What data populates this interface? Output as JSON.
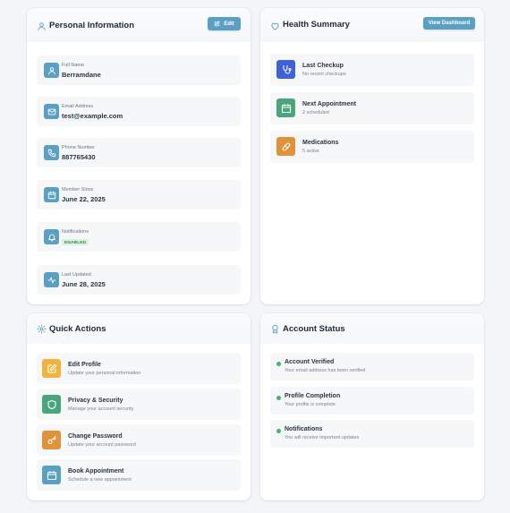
{
  "personal": {
    "title": "Personal Information",
    "edit_label": "Edit",
    "items": [
      {
        "label": "Full Name",
        "value": "Berramdane"
      },
      {
        "label": "Email Address",
        "value": "test@example.com"
      },
      {
        "label": "Phone Number",
        "value": "887765430"
      },
      {
        "label": "Member Since",
        "value": "June 22, 2025"
      },
      {
        "label": "Notifications",
        "badge": "ENABLED"
      },
      {
        "label": "Last Updated",
        "value": "June 28, 2025"
      }
    ]
  },
  "health": {
    "title": "Health Summary",
    "dashboard_label": "View Dashboard",
    "items": [
      {
        "title": "Last Checkup",
        "subtitle": "No recent checkups"
      },
      {
        "title": "Next Appointment",
        "subtitle": "2 scheduled"
      },
      {
        "title": "Medications",
        "subtitle": "5 active"
      }
    ]
  },
  "quick": {
    "title": "Quick Actions",
    "items": [
      {
        "title": "Edit Profile",
        "subtitle": "Update your personal information"
      },
      {
        "title": "Privacy & Security",
        "subtitle": "Manage your account security"
      },
      {
        "title": "Change Password",
        "subtitle": "Update your account password"
      },
      {
        "title": "Book Appointment",
        "subtitle": "Schedule a new appointment"
      }
    ]
  },
  "account": {
    "title": "Account Status",
    "items": [
      {
        "title": "Account Verified",
        "subtitle": "Your email address has been verified"
      },
      {
        "title": "Profile Completion",
        "subtitle": "Your profile is complete"
      },
      {
        "title": "Notifications",
        "subtitle": "You will receive important updates"
      }
    ]
  },
  "colors": {
    "accent": "#5aa0c3",
    "blue": "#3f63d6",
    "green": "#4aa57c",
    "orange": "#e0923b",
    "yellow": "#f0b43c",
    "status": "#4caf72"
  },
  "icons": {
    "personal_header": "user-icon",
    "edit": "edit-icon",
    "personal_items": [
      "user-icon",
      "mail-icon",
      "phone-icon",
      "calendar-icon",
      "bell-icon",
      "activity-icon"
    ],
    "health_header": "heart-icon",
    "health_items": [
      "stethoscope-icon",
      "calendar-icon",
      "pill-icon"
    ],
    "quick_header": "gear-icon",
    "quick_items": [
      "edit-icon",
      "shield-icon",
      "key-icon",
      "calendar-icon"
    ],
    "account_header": "award-icon"
  }
}
